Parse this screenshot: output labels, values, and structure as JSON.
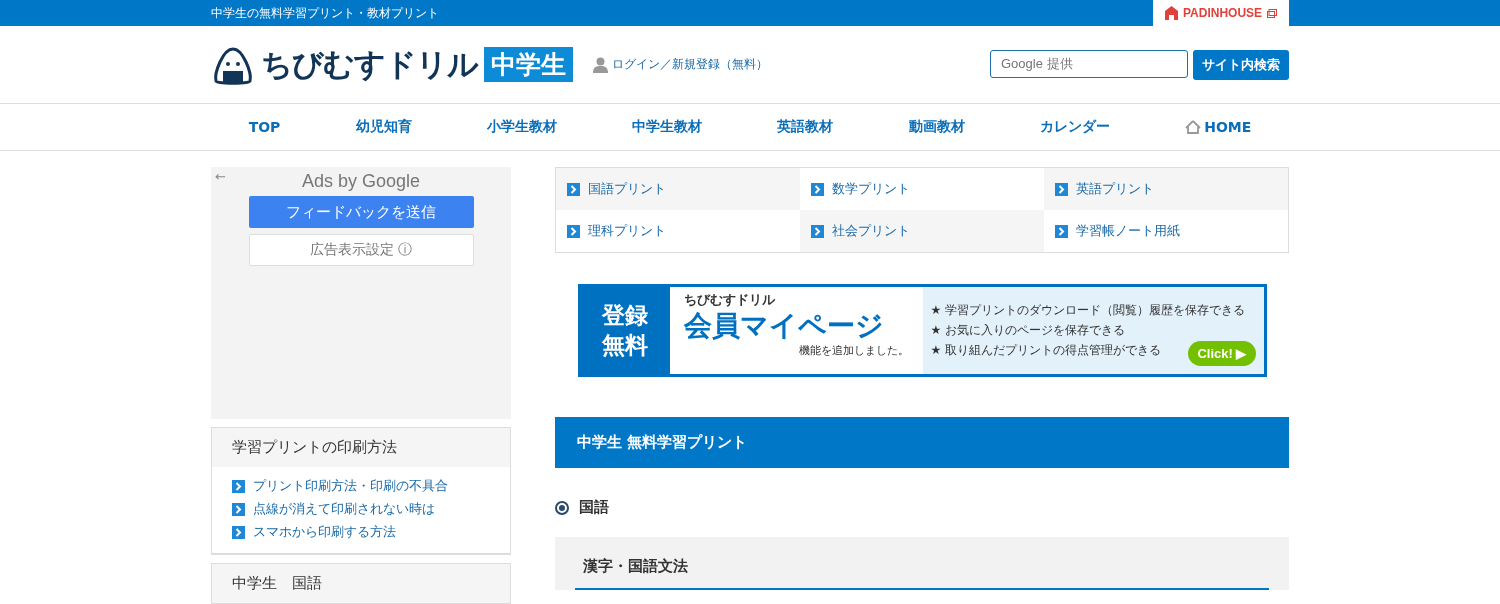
{
  "top_bar": {
    "tagline": "中学生の無料学習プリント・教材プリント",
    "partner": "PADINHOUSE"
  },
  "header": {
    "logo_text": "ちびむすドリル",
    "logo_badge": "中学生",
    "login": "ログイン／新規登録（無料）",
    "search": {
      "placeholder": "Google 提供"
    },
    "search_button": "サイト内検索"
  },
  "nav": [
    {
      "label": "TOP",
      "icon": false
    },
    {
      "label": "幼児知育",
      "icon": false
    },
    {
      "label": "小学生教材",
      "icon": false
    },
    {
      "label": "中学生教材",
      "icon": false
    },
    {
      "label": "英語教材",
      "icon": false
    },
    {
      "label": "動画教材",
      "icon": false
    },
    {
      "label": "カレンダー",
      "icon": false
    },
    {
      "label": "HOME",
      "icon": true
    }
  ],
  "ad": {
    "back": "←",
    "title": "Ads by Google",
    "feedback": "フィードバックを送信",
    "settings": "広告表示設定",
    "info": "ⓘ"
  },
  "sidebar": [
    {
      "title": "学習プリントの印刷方法",
      "links": [
        "プリント印刷方法・印刷の不具合",
        "点線が消えて印刷されない時は",
        "スマホから印刷する方法"
      ]
    },
    {
      "title": "中学生　国語"
    }
  ],
  "subjects": [
    "国語プリント",
    "数学プリント",
    "英語プリント",
    "理科プリント",
    "社会プリント",
    "学習帳ノート用紙"
  ],
  "banner": {
    "left": [
      "登録",
      "無料"
    ],
    "brand": "ちびむすドリル",
    "headline": "会員マイページ",
    "sub": "機能を追加しました。",
    "features": [
      "★ 学習プリントのダウンロード（閲覧）履歴を保存できる",
      "★ お気に入りのページを保存できる",
      "★ 取り組んだプリントの得点管理ができる"
    ],
    "click": "Click! ▶"
  },
  "section_title": "中学生 無料学習プリント",
  "radio": {
    "label": "国語",
    "selected": true
  },
  "subsection": "漢字・国語文法"
}
